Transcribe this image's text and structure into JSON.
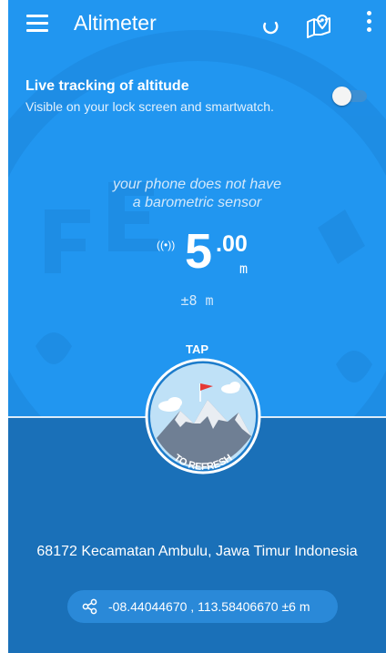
{
  "appbar": {
    "title": "Altimeter",
    "menu_icon": "hamburger-menu-icon",
    "refresh_icon": "refresh-icon",
    "map_icon": "map-pin-icon",
    "more_icon": "more-vertical-icon"
  },
  "live_tracking": {
    "title": "Live tracking of altitude",
    "subtitle": "Visible on your lock screen and smartwatch.",
    "enabled": false
  },
  "sensor_warning": {
    "line1": "your phone does not have",
    "line2": "a barometric sensor"
  },
  "altitude": {
    "signal_icon": "gps-signal-icon",
    "signal_glyph": "((•))",
    "integer": "5",
    "decimal": ".00",
    "unit": "m",
    "accuracy": "±8 m"
  },
  "refresh_badge": {
    "top_label": "TAP",
    "bottom_label": "TO REFRESH"
  },
  "location": {
    "address": "68172 Kecamatan Ambulu, Jawa Timur Indonesia",
    "coordinates": "-08.44044670 , 113.58406670 ±6 m",
    "share_icon": "share-icon"
  },
  "colors": {
    "sky": "#2196f0",
    "lower": "#1a70b8",
    "pill": "#2a89d8"
  }
}
